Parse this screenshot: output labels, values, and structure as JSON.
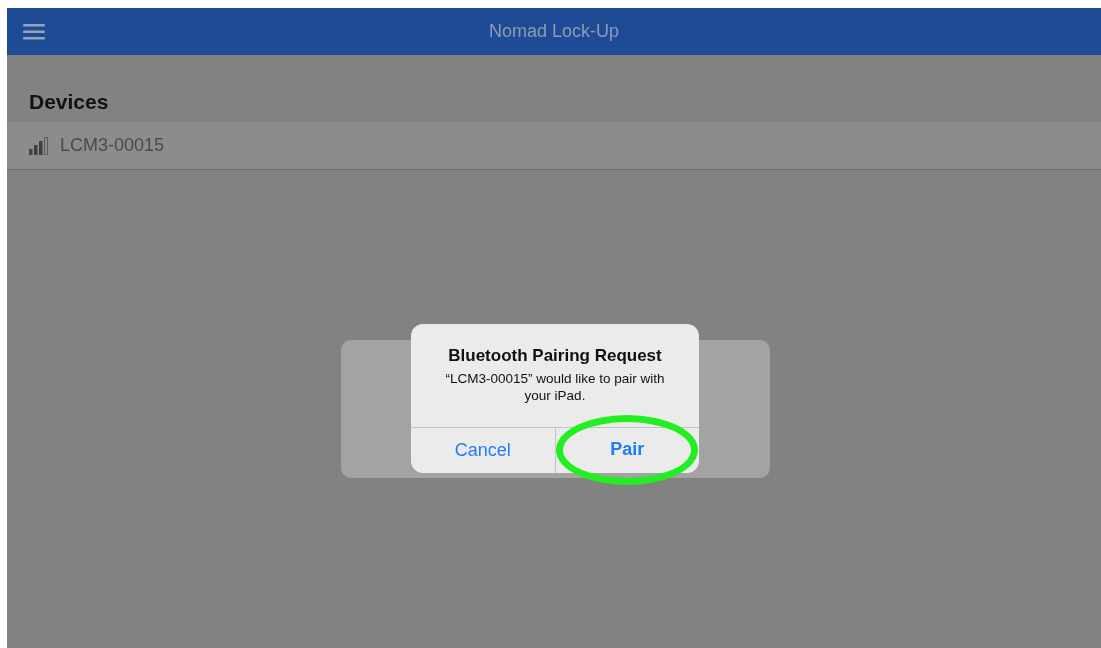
{
  "nav_bar": {
    "title": "Nomad Lock-Up"
  },
  "devices": {
    "heading": "Devices",
    "items": [
      {
        "name": "LCM3-00015"
      }
    ]
  },
  "dialog": {
    "title": "Bluetooth Pairing Request",
    "message": "“LCM3-00015” would like to pair with your iPad.",
    "buttons": [
      {
        "label": "Cancel",
        "kind": "normal",
        "highlighted": false
      },
      {
        "label": "Pair",
        "kind": "preferred",
        "highlighted": true
      }
    ]
  }
}
